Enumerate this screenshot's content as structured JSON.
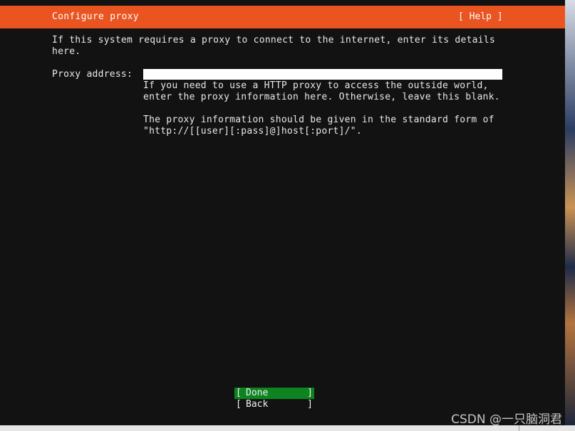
{
  "header": {
    "title": "Configure proxy",
    "help_label": "[ Help ]"
  },
  "intro": {
    "line1": "If this system requires a proxy to connect to the internet, enter its details",
    "line2": "here."
  },
  "proxy": {
    "label": "Proxy address:",
    "value": "",
    "help_line1": "If you need to use a HTTP proxy to access the outside world,",
    "help_line2": "enter the proxy information here. Otherwise, leave this blank.",
    "form_line1": "The proxy information should be given in the standard form of",
    "form_line2": "\"http://[[user][:pass]@]host[:port]/\"."
  },
  "buttons": {
    "done_label": "Done",
    "back_label": "Back",
    "bracket_left": "[",
    "bracket_right": "]"
  },
  "watermark": "CSDN @一只脑洞君",
  "colors": {
    "accent": "#e95420",
    "selected_button": "#0e8420",
    "background": "#121212"
  }
}
